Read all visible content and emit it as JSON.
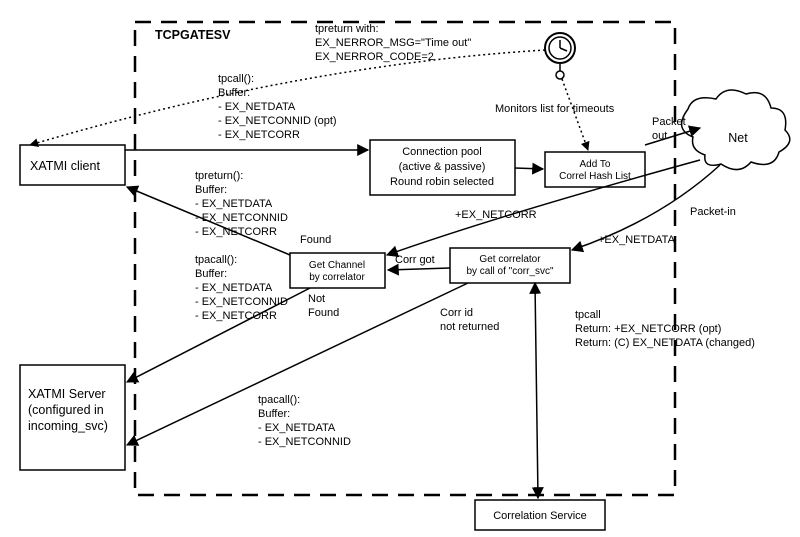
{
  "title": "TCPGATESV",
  "xatmi_client": "XATMI client",
  "xatmi_server": {
    "l1": "XATMI Server",
    "l2": "(configured in",
    "l3": "incoming_svc)"
  },
  "connpool": {
    "l1": "Connection pool",
    "l2": "(active & passive)",
    "l3": "Round robin selected"
  },
  "addhash": {
    "l1": "Add To",
    "l2": "Correl Hash List"
  },
  "getchan": {
    "l1": "Get Channel",
    "l2": "by correlator"
  },
  "getcorr": {
    "l1": "Get correlator",
    "l2": "by call of \"corr_svc\""
  },
  "corrsvc": "Correlation Service",
  "net": "Net",
  "tpreturn_timeout": {
    "l1": "tpreturn with:",
    "l2": "EX_NERROR_MSG=\"Time out\"",
    "l3": "EX_NERROR_CODE=2"
  },
  "monitors": "Monitors list for timeouts",
  "tpcall": {
    "h": "tpcall():",
    "b": "Buffer:",
    "i1": "- EX_NETDATA",
    "i2": "- EX_NETCONNID (opt)",
    "i3": "- EX_NETCORR"
  },
  "tpreturn": {
    "h": "tpreturn():",
    "b": "Buffer:",
    "i1": "- EX_NETDATA",
    "i2": "- EX_NETCONNID",
    "i3": "- EX_NETCORR"
  },
  "tpacall1": {
    "h": "tpacall():",
    "b": "Buffer:",
    "i1": "- EX_NETDATA",
    "i2": "- EX_NETCONNID",
    "i3": "- EX_NETCORR"
  },
  "tpacall2": {
    "h": "tpacall():",
    "b": "Buffer:",
    "i1": "- EX_NETDATA",
    "i2": "- EX_NETCONNID"
  },
  "found": "Found",
  "notfound": {
    "l1": "Not",
    "l2": "Found"
  },
  "corrgot": "Corr got",
  "corrnot": {
    "l1": "Corr id",
    "l2": "not returned"
  },
  "packetout": {
    "l1": "Packet",
    "l2": "out"
  },
  "packetin": "Packet-in",
  "exnetcorr": "+EX_NETCORR",
  "exnetdata": "+EX_NETDATA",
  "tpcall_ret": {
    "l1": "tpcall",
    "l2": "Return: +EX_NETCORR (opt)",
    "l3": "Return: (C) EX_NETDATA (changed)"
  }
}
